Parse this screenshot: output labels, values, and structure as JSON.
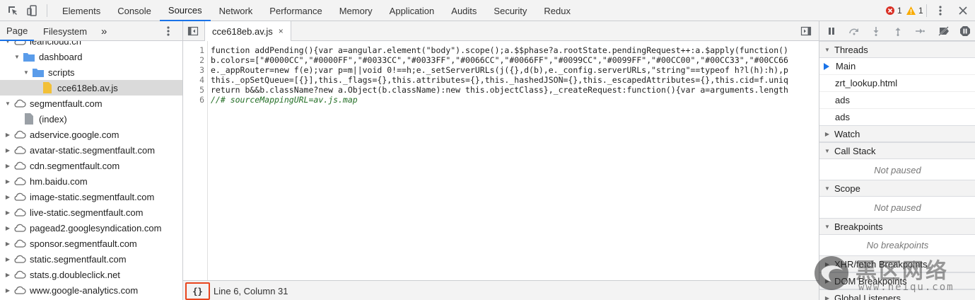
{
  "toolbar": {
    "tabs": [
      "Elements",
      "Console",
      "Sources",
      "Network",
      "Performance",
      "Memory",
      "Application",
      "Audits",
      "Security",
      "Redux"
    ],
    "active_tab": "Sources",
    "error_count": "1",
    "warning_count": "1"
  },
  "navigator": {
    "tabs": [
      "Page",
      "Filesystem"
    ],
    "more": "»",
    "tree": [
      {
        "label": "leancloud.cn",
        "kind": "cloud",
        "depth": 1,
        "expanded": true
      },
      {
        "label": "dashboard",
        "kind": "folder",
        "depth": 2,
        "expanded": true
      },
      {
        "label": "scripts",
        "kind": "folder",
        "depth": 3,
        "expanded": true
      },
      {
        "label": "cce618eb.av.js",
        "kind": "file-js",
        "depth": 4,
        "selected": true
      },
      {
        "label": "segmentfault.com",
        "kind": "cloud",
        "depth": 1,
        "expanded": true
      },
      {
        "label": "(index)",
        "kind": "file",
        "depth": 2
      },
      {
        "label": "adservice.google.com",
        "kind": "cloud",
        "depth": 1
      },
      {
        "label": "avatar-static.segmentfault.com",
        "kind": "cloud",
        "depth": 1
      },
      {
        "label": "cdn.segmentfault.com",
        "kind": "cloud",
        "depth": 1
      },
      {
        "label": "hm.baidu.com",
        "kind": "cloud",
        "depth": 1
      },
      {
        "label": "image-static.segmentfault.com",
        "kind": "cloud",
        "depth": 1
      },
      {
        "label": "live-static.segmentfault.com",
        "kind": "cloud",
        "depth": 1
      },
      {
        "label": "pagead2.googlesyndication.com",
        "kind": "cloud",
        "depth": 1
      },
      {
        "label": "sponsor.segmentfault.com",
        "kind": "cloud",
        "depth": 1
      },
      {
        "label": "static.segmentfault.com",
        "kind": "cloud",
        "depth": 1
      },
      {
        "label": "stats.g.doubleclick.net",
        "kind": "cloud",
        "depth": 1
      },
      {
        "label": "www.google-analytics.com",
        "kind": "cloud",
        "depth": 1
      }
    ]
  },
  "editor": {
    "file_tab": "cce618eb.av.js",
    "close": "×",
    "line_numbers": [
      "1",
      "2",
      "3",
      "4",
      "5",
      "6"
    ],
    "lines": [
      "function addPending(){var a=angular.element(\"body\").scope();a.$$phase?a.rootState.pendingRequest++:a.$apply(function()",
      "b.colors=[\"#0000CC\",\"#0000FF\",\"#0033CC\",\"#0033FF\",\"#0066CC\",\"#0066FF\",\"#0099CC\",\"#0099FF\",\"#00CC00\",\"#00CC33\",\"#00CC66",
      "e._appRouter=new f(e);var p=m||void 0!==h;e._setServerURLs(j({},d(b),e._config.serverURLs,\"string\"==typeof h?l(h):h),p",
      "this._opSetQueue=[{}],this._flags={},this.attributes={},this._hashedJSON={},this._escapedAttributes={},this.cid=f.uniq",
      "return b&&b.className?new a.Object(b.className):new this.objectClass},_createRequest:function(){var a=arguments.length",
      "//# sourceMappingURL=av.js.map"
    ],
    "pretty_print": "{}",
    "cursor_position": "Line 6, Column 31"
  },
  "debugger": {
    "threads": {
      "title": "Threads",
      "items": [
        "Main",
        "zrt_lookup.html",
        "ads",
        "ads"
      ]
    },
    "watch": "Watch",
    "call_stack": {
      "title": "Call Stack",
      "empty": "Not paused"
    },
    "scope": {
      "title": "Scope",
      "empty": "Not paused"
    },
    "breakpoints": {
      "title": "Breakpoints",
      "empty": "No breakpoints"
    },
    "xhr_breakpoints": "XHR/fetch Breakpoints",
    "dom_breakpoints": "DOM Breakpoints",
    "global_listeners": "Global Listeners"
  },
  "watermark": {
    "name": "黑区网络",
    "url": "www.heiqu.com"
  },
  "colors": {
    "accent": "#1a73e8",
    "highlight_box": "#e8451e",
    "folder": "#5a9cea",
    "file_js": "#f2c037",
    "error": "#d93025",
    "warning": "#f9ab00"
  }
}
